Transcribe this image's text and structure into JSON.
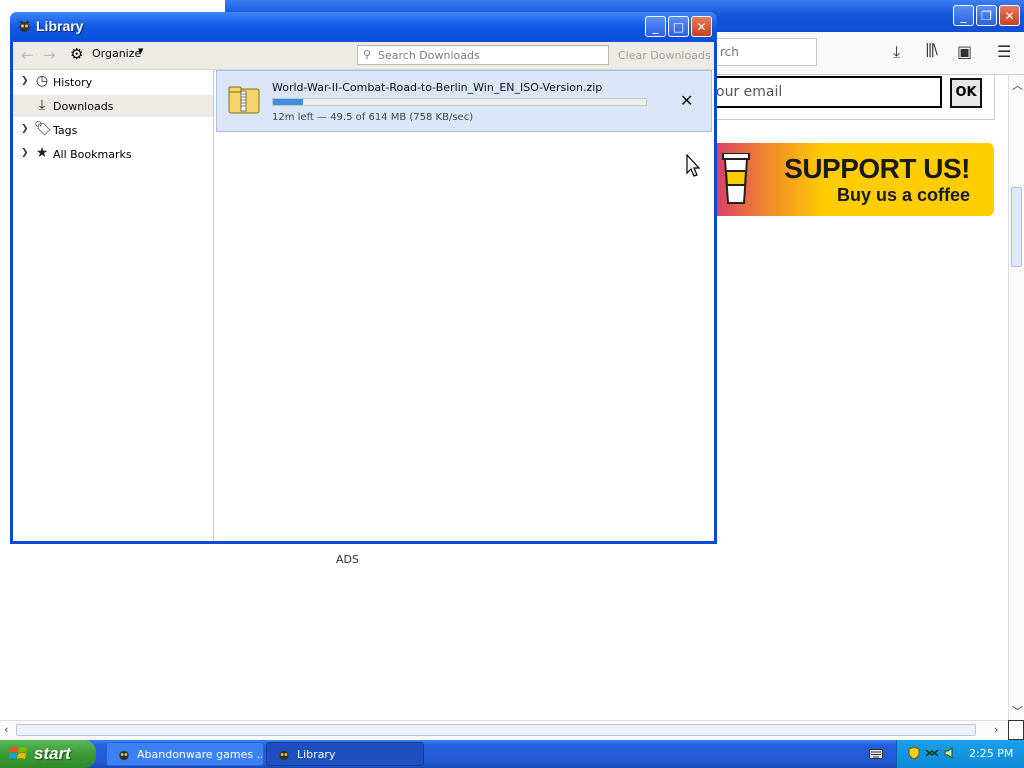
{
  "browser": {
    "search_placeholder": "rch",
    "email_placeholder": "our email",
    "ok_label": "OK",
    "support_title": "SUPPORT US!",
    "support_subtitle": "Buy us a coffee",
    "ads_label": "ADS"
  },
  "library": {
    "title": "Library",
    "organize_label": "Organize",
    "search_placeholder": "Search Downloads",
    "clear_label": "Clear Downloads",
    "sidebar": [
      {
        "label": "History",
        "icon": "clock-icon",
        "expandable": true
      },
      {
        "label": "Downloads",
        "icon": "download-icon",
        "expandable": false,
        "selected": true
      },
      {
        "label": "Tags",
        "icon": "tag-icon",
        "expandable": true
      },
      {
        "label": "All Bookmarks",
        "icon": "star-icon",
        "expandable": true
      }
    ],
    "download": {
      "filename": "World-War-II-Combat-Road-to-Berlin_Win_EN_ISO-Version.zip",
      "status": "12m left — 49.5 of 614 MB (758 KB/sec)",
      "progress": 0.08
    }
  },
  "taskbar": {
    "start_label": "start",
    "tasks": [
      {
        "label": "Abandonware games ..."
      },
      {
        "label": "Library"
      }
    ],
    "clock": "2:25 PM"
  },
  "colors": {
    "xp_blue": "#0a49d6",
    "progress": "#3b8de6",
    "download_row": "#dae6f7",
    "support_yellow": "#ffcd00"
  }
}
